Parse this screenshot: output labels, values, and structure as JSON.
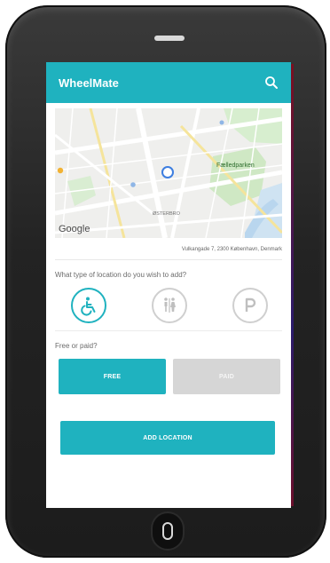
{
  "app": {
    "title": "WheelMate",
    "search_icon": "search-icon"
  },
  "map": {
    "attribution": "Google",
    "labels": {
      "park": "Fælledparken",
      "area": "ØSTERBRO"
    },
    "address": "Vulkangade 7, 2300 København, Denmark"
  },
  "location_type": {
    "question": "What type of location do you wish to add?",
    "options": [
      {
        "icon": "wheelchair-icon",
        "selected": true
      },
      {
        "icon": "toilet-icon",
        "selected": false
      },
      {
        "icon": "parking-icon",
        "selected": false
      }
    ]
  },
  "cost": {
    "question": "Free or paid?",
    "options": [
      {
        "label": "FREE",
        "active": true
      },
      {
        "label": "PAID",
        "active": false
      }
    ]
  },
  "actions": {
    "add_location_label": "ADD LOCATION"
  },
  "colors": {
    "accent": "#1fb2bf",
    "inactive": "#d6d6d6",
    "device": "#232323"
  }
}
